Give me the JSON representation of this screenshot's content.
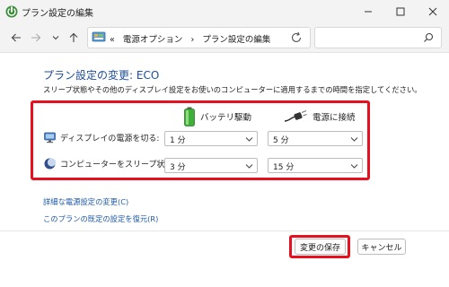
{
  "window": {
    "title": "プラン設定の編集"
  },
  "nav": {
    "breadcrumb_prefix": "«",
    "breadcrumb_parent": "電源オプション",
    "breadcrumb_sep": "›",
    "breadcrumb_current": "プラン設定の編集",
    "search_placeholder": ""
  },
  "content": {
    "heading": "プラン設定の変更: ECO",
    "description": "スリープ状態やその他のディスプレイ設定をお使いのコンピューターに適用するまでの時間を指定してください。",
    "columns": {
      "battery": "バッテリ駆動",
      "plugged": "電源に接続"
    },
    "rows": [
      {
        "label": "ディスプレイの電源を切る:",
        "battery_value": "1 分",
        "plugged_value": "5 分"
      },
      {
        "label": "コンピューターをスリープ状態にする:",
        "battery_value": "3 分",
        "plugged_value": "15 分"
      }
    ],
    "links": {
      "advanced": "詳細な電源設定の変更(C)",
      "restore": "このプランの既定の設定を復元(R)"
    }
  },
  "footer": {
    "save_label": "変更の保存",
    "cancel_label": "キャンセル"
  },
  "colors": {
    "accent_heading": "#1e4d9b",
    "link": "#1e5aa8",
    "highlight": "#e8101e"
  }
}
